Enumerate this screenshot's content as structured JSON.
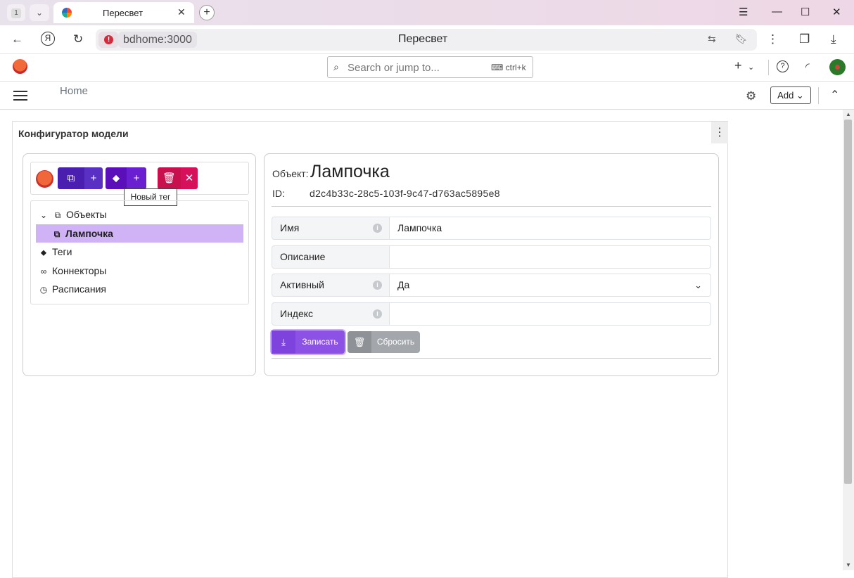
{
  "browser": {
    "tab_count": "1",
    "tab_title": "Пересвет",
    "url_host": "bdhome:3000",
    "page_title": "Пересвет"
  },
  "app": {
    "search_placeholder": "Search or jump to...",
    "search_shortcut": "ctrl+k",
    "breadcrumb": "Home",
    "add_label": "Add"
  },
  "panel": {
    "title": "Конфигуратор модели",
    "tooltip": "Новый тег",
    "tree": [
      {
        "label": "Объекты",
        "icon": "diagram-icon"
      },
      {
        "label": "Лампочка",
        "icon": "diagram-icon"
      },
      {
        "label": "Теги",
        "icon": "tags-icon"
      },
      {
        "label": "Коннекторы",
        "icon": "link-icon"
      },
      {
        "label": "Расписания",
        "icon": "clock-icon"
      }
    ]
  },
  "detail": {
    "object_label": "Объект:",
    "object_name": "Лампочка",
    "id_label": "ID:",
    "id_value": "d2c4b33c-28c5-103f-9c47-d763ac5895e8",
    "fields": [
      {
        "label": "Имя",
        "value": "Лампочка",
        "info": true
      },
      {
        "label": "Описание",
        "value": "",
        "info": false
      },
      {
        "label": "Активный",
        "value": "Да",
        "info": true
      },
      {
        "label": "Индекс",
        "value": "",
        "info": true
      }
    ],
    "save_label": "Записать",
    "reset_label": "Сбросить"
  },
  "colors": {
    "selected_row": "#d0b3f7",
    "primary": "#8c52e6",
    "danger": "#d6105a"
  }
}
